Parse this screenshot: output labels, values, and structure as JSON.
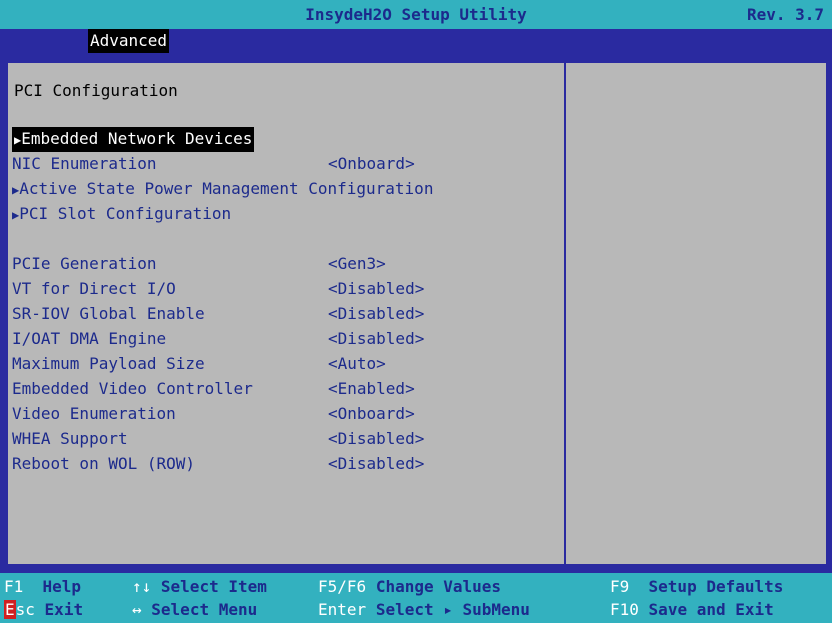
{
  "title": "InsydeH2O Setup Utility",
  "revision": "Rev. 3.7",
  "menu": {
    "active_tab": "Advanced"
  },
  "panel": {
    "section_title": "PCI Configuration",
    "items": [
      {
        "label": "Embedded Network Devices",
        "submenu": true,
        "value": "",
        "selected": true
      },
      {
        "label": "NIC Enumeration",
        "submenu": false,
        "value": "<Onboard>"
      },
      {
        "label": "Active State Power Management Configuration",
        "submenu": true,
        "value": ""
      },
      {
        "label": "PCI Slot Configuration",
        "submenu": true,
        "value": ""
      },
      {
        "label": "PCIe Generation",
        "submenu": false,
        "value": "<Gen3>"
      },
      {
        "label": "VT for Direct I/O",
        "submenu": false,
        "value": "<Disabled>"
      },
      {
        "label": "SR-IOV Global Enable",
        "submenu": false,
        "value": "<Disabled>"
      },
      {
        "label": "I/OAT DMA Engine",
        "submenu": false,
        "value": "<Disabled>"
      },
      {
        "label": "Maximum Payload Size",
        "submenu": false,
        "value": "<Auto>"
      },
      {
        "label": "Embedded Video Controller",
        "submenu": false,
        "value": "<Enabled>"
      },
      {
        "label": "Video Enumeration",
        "submenu": false,
        "value": "<Onboard>"
      },
      {
        "label": "WHEA Support",
        "submenu": false,
        "value": "<Disabled>"
      },
      {
        "label": "Reboot on WOL (ROW)",
        "submenu": false,
        "value": "<Disabled>"
      }
    ]
  },
  "footer": {
    "f1_key": "F1",
    "f1_desc": "Help",
    "esc_key_first": "E",
    "esc_key_rest": "sc",
    "esc_desc": "Exit",
    "updown_key": "↑↓",
    "updown_desc": "Select Item",
    "leftright_key": "↔",
    "leftright_desc": "Select Menu",
    "f5f6_key": "F5/F6",
    "f5f6_desc": "Change Values",
    "enter_key": "Enter",
    "enter_desc": "Select ▸ SubMenu",
    "f9_key": "F9",
    "f9_desc": "Setup Defaults",
    "f10_key": "F10",
    "f10_desc": "Save and Exit"
  },
  "colors": {
    "background": "#2a2aa0",
    "bar": "#33b1bf",
    "panel": "#b8b8b8",
    "text_blue": "#1c2a8c",
    "esc_red": "#d02020"
  }
}
